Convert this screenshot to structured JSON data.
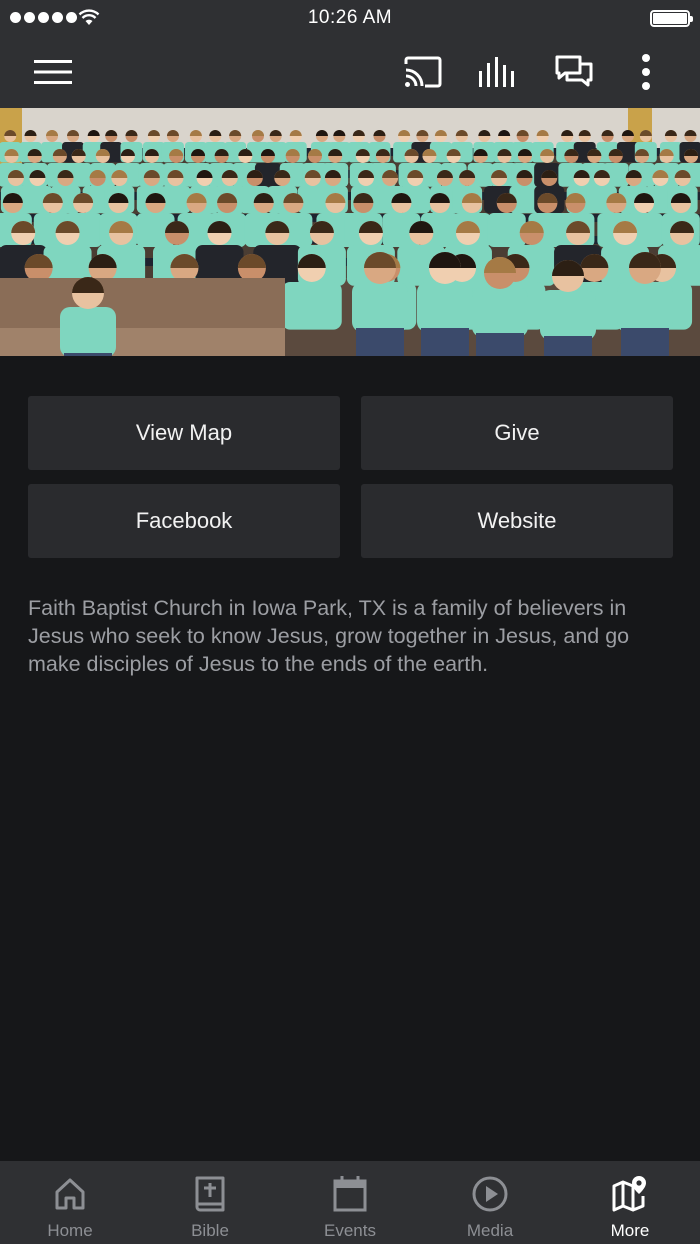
{
  "status_bar": {
    "time": "10:26 AM",
    "signal_bars": 5,
    "battery_level": 1.0
  },
  "toolbar": {
    "icons": [
      "menu-icon",
      "cast-icon",
      "audio-bars-icon",
      "chat-icon",
      "more-vertical-icon"
    ]
  },
  "actions": {
    "view_map": "View Map",
    "give": "Give",
    "facebook": "Facebook",
    "website": "Website"
  },
  "description": "Faith Baptist Church in Iowa Park, TX is a family of believers in Jesus who seek to know Jesus, grow together in Jesus, and go make disciples of Jesus to the ends of the earth.",
  "tabs": [
    {
      "label": "Home",
      "icon": "home-icon",
      "active": false
    },
    {
      "label": "Bible",
      "icon": "bible-icon",
      "active": false
    },
    {
      "label": "Events",
      "icon": "calendar-icon",
      "active": false
    },
    {
      "label": "Media",
      "icon": "play-icon",
      "active": false
    },
    {
      "label": "More",
      "icon": "map-icon",
      "active": true
    }
  ],
  "colors": {
    "background": "#161719",
    "bar": "#2f3033",
    "button": "#2a2b2e",
    "text_muted": "#9c9ea3",
    "tab_inactive": "#8d8f94",
    "shirt": "#7fd6bf"
  }
}
